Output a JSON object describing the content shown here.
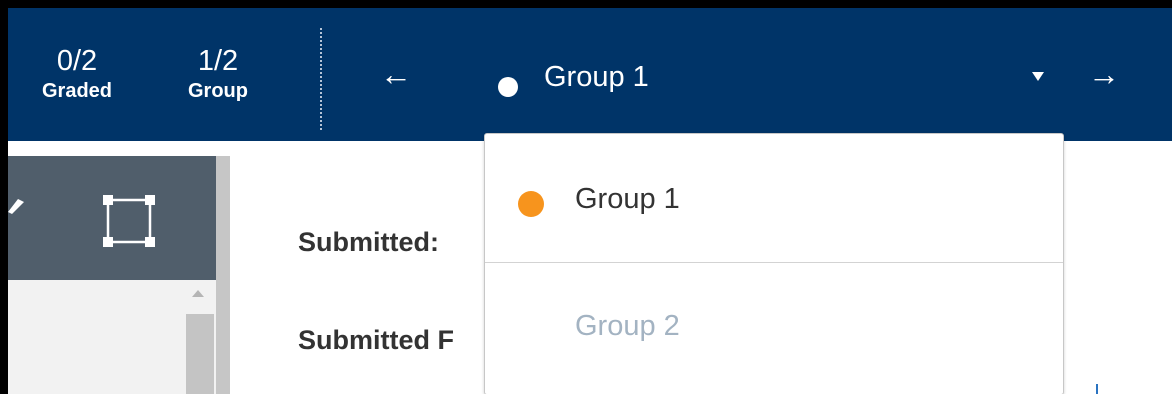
{
  "counters": {
    "graded": {
      "value": "0/2",
      "label": "Graded"
    },
    "group": {
      "value": "1/2",
      "label": "Group"
    }
  },
  "navigation": {
    "prev_icon": "arrow-left-icon",
    "next_icon": "arrow-right-icon",
    "prev_glyph": "←",
    "next_glyph": "→",
    "selected_group": "Group 1"
  },
  "toolbar": {
    "pen_icon": "pen-icon",
    "rect_icon": "rectangle-select-icon"
  },
  "details": {
    "submitted": "Submitted:",
    "submitted_files": "Submitted F"
  },
  "dropdown": {
    "options": [
      {
        "label": "Group 1",
        "status": "current"
      },
      {
        "label": "Group 2",
        "status": "disabled"
      }
    ]
  },
  "colors": {
    "nav_bg": "#003468",
    "toolbar_bg": "#505e6b",
    "current_dot": "#f7941d",
    "inactive_text": "#a3b3c2"
  }
}
